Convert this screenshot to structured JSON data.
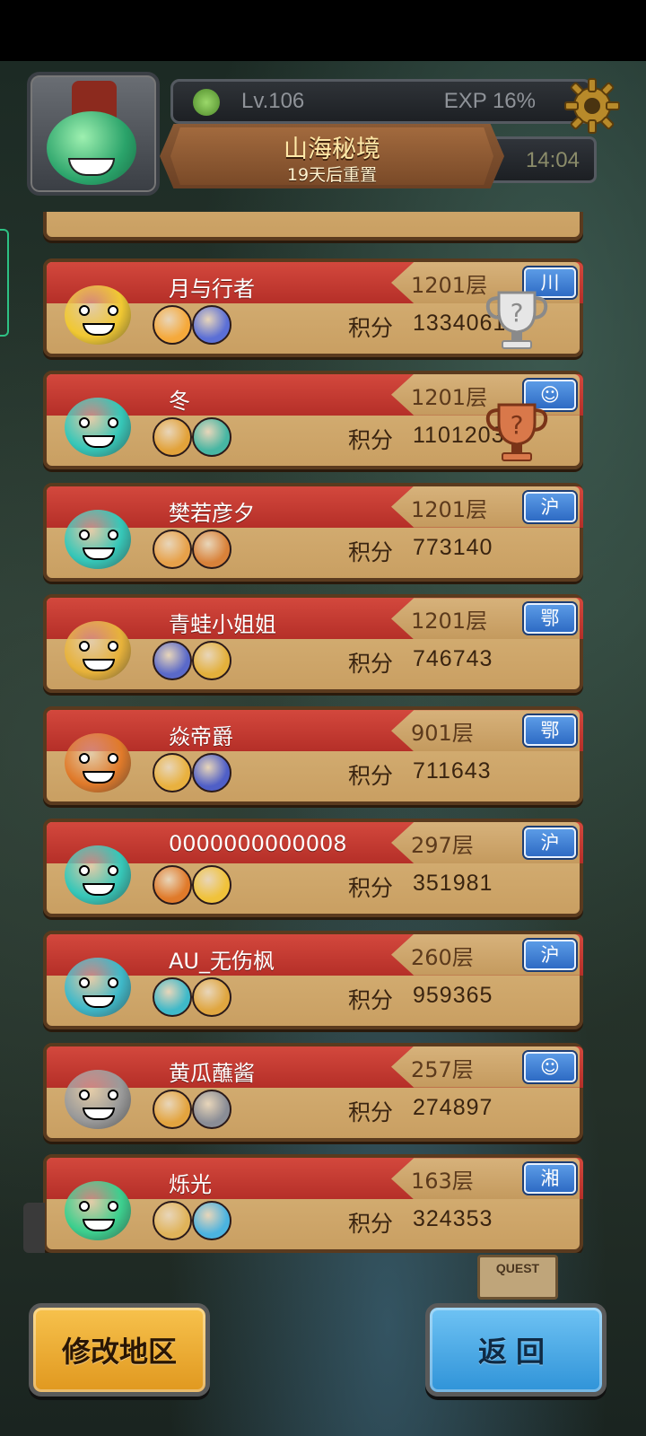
{
  "header": {
    "level": "Lv.106",
    "exp": "EXP 16%",
    "title": "山海秘境",
    "subtitle": "19天后重置",
    "time": "14:04"
  },
  "score_label": "积分",
  "entries": [
    {
      "name": "月与行者",
      "floor": "1201层",
      "score": "1334061",
      "region": "川",
      "face_color": "#f0c832",
      "trophy": "silver"
    },
    {
      "name": "冬",
      "floor": "1201层",
      "score": "1101203",
      "region": "☺",
      "face_color": "#36c7b8",
      "trophy": "bronze"
    },
    {
      "name": "樊若彦夕",
      "floor": "1201层",
      "score": "773140",
      "region": "沪",
      "face_color": "#36c7b8"
    },
    {
      "name": "青蛙小姐姐",
      "floor": "1201层",
      "score": "746743",
      "region": "鄂",
      "face_color": "#e7b23a"
    },
    {
      "name": "焱帝爵",
      "floor": "901层",
      "score": "711643",
      "region": "鄂",
      "face_color": "#e07a2a"
    },
    {
      "name": "0000000000008",
      "floor": "297层",
      "score": "351981",
      "region": "沪",
      "face_color": "#36c7b8"
    },
    {
      "name": "AU_无伤枫",
      "floor": "260层",
      "score": "959365",
      "region": "沪",
      "face_color": "#3fb9c9"
    },
    {
      "name": "黄瓜蘸酱",
      "floor": "257层",
      "score": "274897",
      "region": "☺",
      "face_color": "#9a9a9a"
    },
    {
      "name": "烁光",
      "floor": "163层",
      "score": "324353",
      "region": "湘",
      "face_color": "#3ccf8e"
    }
  ],
  "buttons": {
    "change_region": "修改地区",
    "back": "返回"
  },
  "quest_sign": "QUEST"
}
